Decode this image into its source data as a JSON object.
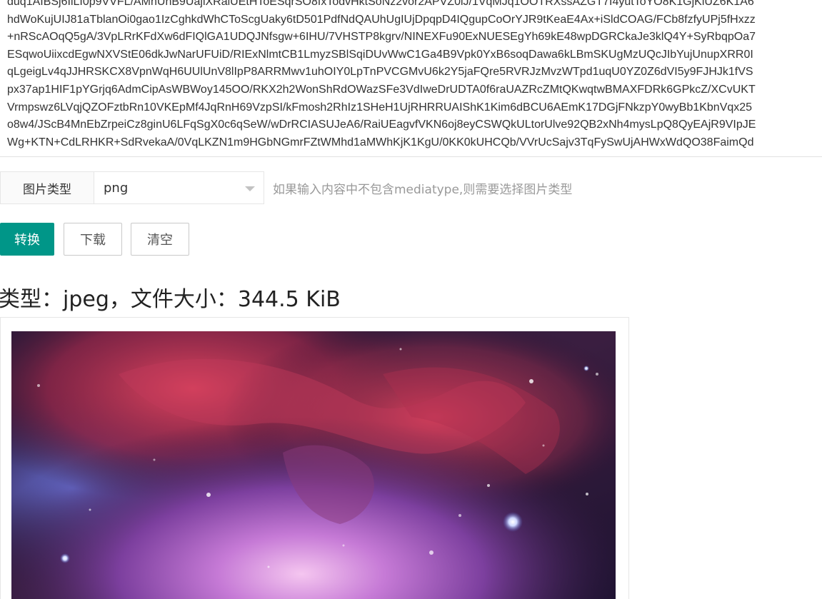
{
  "base64_input": {
    "lines": [
      "duq1AIBSj6IiLI0p9VVFL/AMnUnB9UajiXRaiUEtHToESqrSO8fxTodvHktSoNz2vor2APVZ0iJ/1VqMJq1OOTRXssAZGT7I4yutToYO8K1GjKiUZ6K1A6",
      "hdWoKujUIJ81aTblanOi0gao1IzCghkdWhCToScgUaky6tD501PdfNdQAUhUgIUjDpqpD4IQgupCoOrYJR9tKeaE4Ax+iSldCOAG/FCb8fzfyUPj5fHxzz",
      "+nRScAOqQ5gA/3VpLRrKFdXw6dFIQlGA1UDQJNfsgw+6IHU/7VHSTP8kgrv/NINEXFu90ExNUESEgYh69kE48wpDGRCkaJe3klQ4Y+SyRbqpOa7",
      "ESqwoUiixcdEgwNXVStE06dkJwNarUFUiD/RIExNlmtCB1LmyzSBlSqiDUvWwC1Ga4B9Vpk0YxB6soqDawa6kLBmSKUgMzUQcJIbYujUnupXRR0I",
      "qLgeigLv4qJJHRSKCX8VpnWqH6UUlUnV8lIpP8ARRMwv1uhOIY0LpTnPVCGMvU6k2Y5jaFQre5RVRJzMvzWTpd1uqU0YZ0Z6dVI5y9FJHJk1fVS",
      "px37ap1HIF1pYGrjq6AdmCipAsWBWoy145OO/RKX2h2WonShRdOWazSFe3VdIweDrUDTA0f6raUAZRcZMtQKwqtwBMAXFDRk6GPkcZ/XCvUKT",
      "Vrmpswz6LVqjQZOFztbRn10VKEpMf4JqRnH69VzpSI/kFmosh2RhIz1SHeH1UjRHRRUAIShK1Kim6dBCU6AEmK17DGjFNkzpY0wyBb1KbnVqx25",
      "o8w4/JScB4MnEbZrpeiCz8ginU6LFqSgX0c6qSeW/wDrRCIASUJeA6/RaiUEagvfVKN6oj8eyCSWQkULtorUlve92QB2xNh4mysLpQ8QyEAjR9VIpJE",
      "Wg+KTN+CdLRHKR+SdRvekaA/0VqLKZN1m9HGbNGmrFZtWMhd1aMWhKjK1KgU/0KK0kUHCQb/VVrUcSajv3TqFySwUjAHWxWdQO38FaimQd"
    ]
  },
  "image_type": {
    "label": "图片类型",
    "selected": "png",
    "hint": "如果输入内容中不包含mediatype,则需要选择图片类型"
  },
  "actions": {
    "convert": "转换",
    "download": "下载",
    "clear": "清空"
  },
  "result": {
    "info": "类型：jpeg，文件大小：344.5 KiB"
  },
  "colors": {
    "primary": "#009688",
    "hint": "#999999",
    "border": "#e6e6e6"
  }
}
